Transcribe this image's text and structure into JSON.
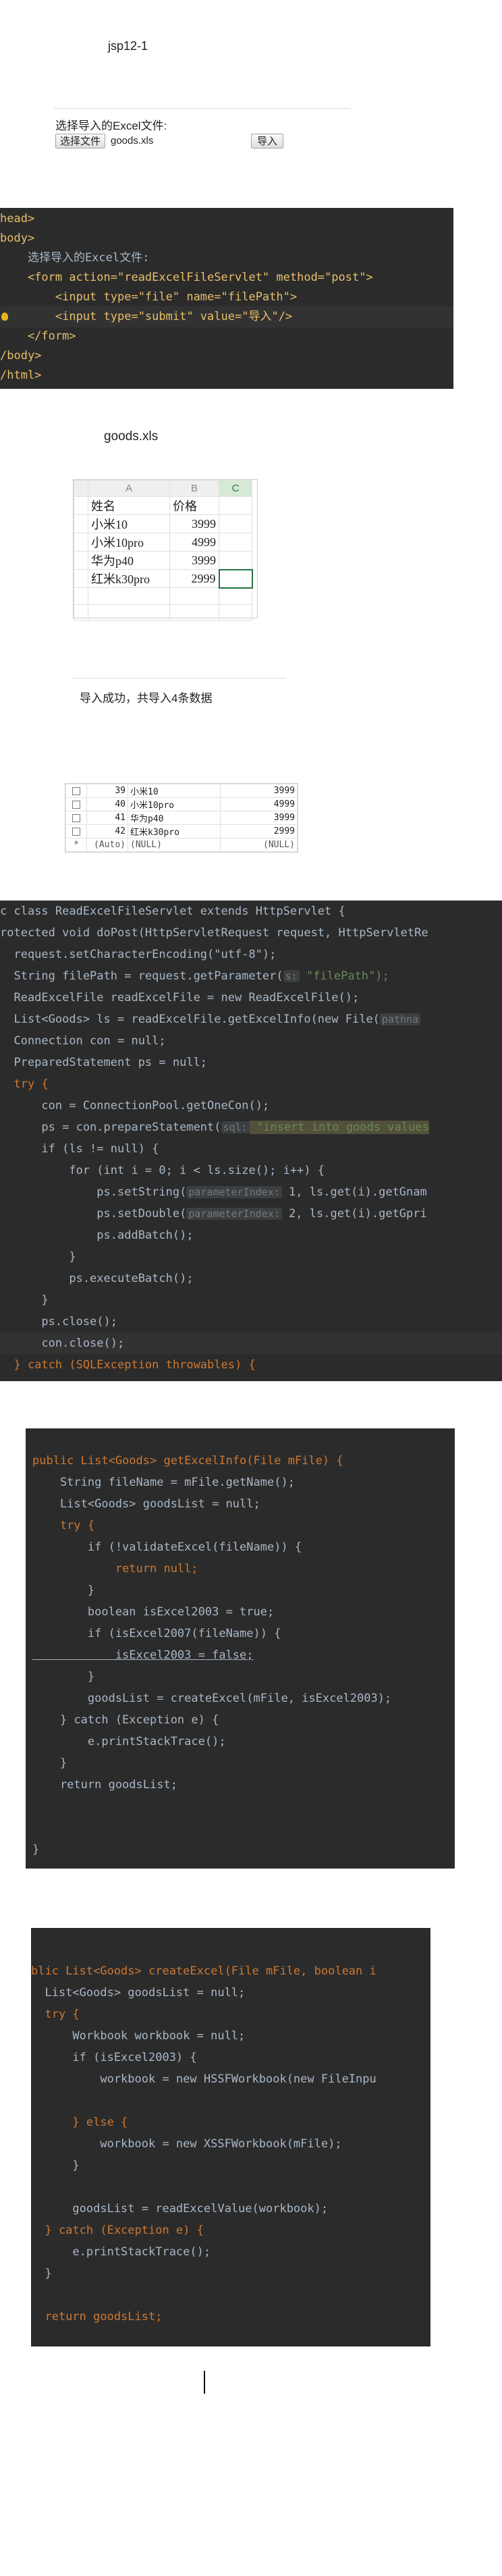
{
  "header": {
    "title": "jsp12-1"
  },
  "form_preview": {
    "label": "选择导入的Excel文件:",
    "file_button": "选择文件",
    "file_name": "goods.xls",
    "import_button": "导入"
  },
  "jsp_code": {
    "lines": [
      "head>",
      "body>",
      "    选择导入的Excel文件:",
      "    <form action=\"readExcelFileServlet\" method=\"post\">",
      "        <input type=\"file\" name=\"filePath\">",
      "        <input type=\"submit\" value=\"导入\"/>",
      "    </form>",
      "/body>",
      "/html>"
    ]
  },
  "excel_sheet": {
    "file_title": "goods.xls",
    "col_headers": [
      "A",
      "B",
      "C"
    ],
    "rows": [
      [
        "姓名",
        "价格"
      ],
      [
        "小米10",
        "3999"
      ],
      [
        "小米10pro",
        "4999"
      ],
      [
        "华为p40",
        "3999"
      ],
      [
        "红米k30pro",
        "2999"
      ]
    ]
  },
  "result_message": "导入成功，共导入4条数据",
  "db_table": {
    "rows": [
      [
        "39",
        "小米10",
        "3999"
      ],
      [
        "40",
        "小米10pro",
        "4999"
      ],
      [
        "41",
        "华为p40",
        "3999"
      ],
      [
        "42",
        "红米k30pro",
        "2999"
      ],
      [
        "(Auto)",
        "(NULL)",
        "(NULL)"
      ]
    ],
    "new_row_marker": "*"
  },
  "servlet_code": {
    "line1": "c class ReadExcelFileServlet extends HttpServlet {",
    "line2": "rotected void doPost(HttpServletRequest request, HttpServletRe",
    "line3": "  request.setCharacterEncoding(\"utf-8\");",
    "line4_a": "  String filePath = request.getParameter(",
    "line4_hint": "s:",
    "line4_b": " \"filePath\");",
    "line5": "  ReadExcelFile readExcelFile = new ReadExcelFile();",
    "line6_a": "  List<Goods> ls = readExcelFile.getExcelInfo(new File(",
    "line6_hint": "pathna",
    "line7": "  Connection con = null;",
    "line8": "  PreparedStatement ps = null;",
    "line9": "  try {",
    "line10": "      con = ConnectionPool.getOneCon();",
    "line11_a": "      ps = con.prepareStatement(",
    "line11_hint": "sql:",
    "line11_b": " \"insert into goods values",
    "line12": "      if (ls != null) {",
    "line13": "          for (int i = 0; i < ls.size(); i++) {",
    "line14_a": "              ps.setString(",
    "line14_hint": "parameterIndex:",
    "line14_b": " 1, ls.get(i).getGnam",
    "line15_a": "              ps.setDouble(",
    "line15_hint": "parameterIndex:",
    "line15_b": " 2, ls.get(i).getGpri",
    "line16": "              ps.addBatch();",
    "line17": "          }",
    "line18": "          ps.executeBatch();",
    "line19": "      }",
    "line20": "      ps.close();",
    "line21": "      con.close();",
    "line22": "  } catch (SQLException throwables) {"
  },
  "get_excel_info_code": {
    "lines": [
      "public List<Goods> getExcelInfo(File mFile) {",
      "    String fileName = mFile.getName();",
      "    List<Goods> goodsList = null;",
      "    try {",
      "        if (!validateExcel(fileName)) {",
      "            return null;",
      "        }",
      "        boolean isExcel2003 = true;",
      "        if (isExcel2007(fileName)) {",
      "            isExcel2003 = false;",
      "        }",
      "        goodsList = createExcel(mFile, isExcel2003);",
      "    } catch (Exception e) {",
      "        e.printStackTrace();",
      "    }",
      "    return goodsList;",
      "",
      "",
      "}"
    ]
  },
  "create_excel_code": {
    "lines": [
      "blic List<Goods> createExcel(File mFile, boolean i",
      "  List<Goods> goodsList = null;",
      "  try {",
      "      Workbook workbook = null;",
      "      if (isExcel2003) {",
      "          workbook = new HSSFWorkbook(new FileInpu",
      "",
      "      } else {",
      "          workbook = new XSSFWorkbook(mFile);",
      "      }",
      "",
      "      goodsList = readExcelValue(workbook);",
      "  } catch (Exception e) {",
      "      e.printStackTrace();",
      "  }",
      "",
      "  return goodsList;"
    ]
  }
}
